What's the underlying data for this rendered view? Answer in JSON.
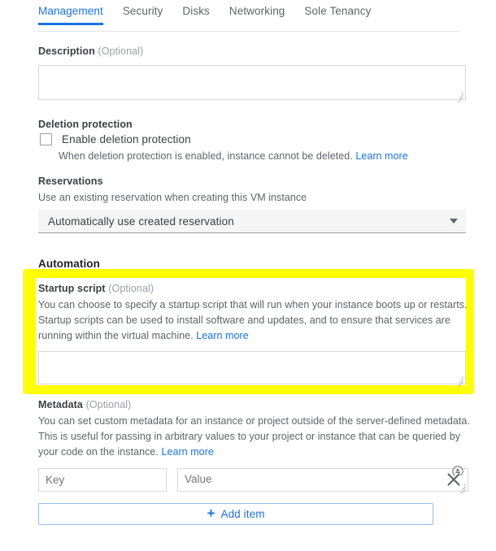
{
  "tabs": [
    {
      "label": "Management",
      "active": true
    },
    {
      "label": "Security",
      "active": false
    },
    {
      "label": "Disks",
      "active": false
    },
    {
      "label": "Networking",
      "active": false
    },
    {
      "label": "Sole Tenancy",
      "active": false
    }
  ],
  "description": {
    "label": "Description",
    "optional": "(Optional)",
    "value": "",
    "placeholder": ""
  },
  "deletion_protection": {
    "heading": "Deletion protection",
    "checkbox_label": "Enable deletion protection",
    "checked": false,
    "help": "When deletion protection is enabled, instance cannot be deleted.",
    "learn_more": "Learn more"
  },
  "reservations": {
    "heading": "Reservations",
    "help": "Use an existing reservation when creating this VM instance",
    "selected": "Automatically use created reservation"
  },
  "automation": {
    "heading": "Automation",
    "startup_script": {
      "label": "Startup script",
      "optional": "(Optional)",
      "help": "You can choose to specify a startup script that will run when your instance boots up or restarts. Startup scripts can be used to install software and updates, and to ensure that services are running within the virtual machine.",
      "learn_more": "Learn more",
      "value": "",
      "placeholder": ""
    }
  },
  "metadata": {
    "label": "Metadata",
    "optional": "(Optional)",
    "help": "You can set custom metadata for an instance or project outside of the server-defined metadata. This is useful for passing in arbitrary values to your project or instance that can be queried by your code on the instance.",
    "learn_more": "Learn more",
    "rows": [
      {
        "key_value": "",
        "key_placeholder": "Key",
        "value_value": "",
        "value_placeholder": "Value"
      }
    ],
    "add_item_label": "Add item",
    "add_item_plus": "+"
  },
  "colors": {
    "accent": "#1a73e8",
    "highlight": "#ffff00",
    "text": "#3c4043",
    "muted": "#5f6368",
    "optional": "#9aa0a6",
    "field_bg": "#f5f5f5"
  }
}
